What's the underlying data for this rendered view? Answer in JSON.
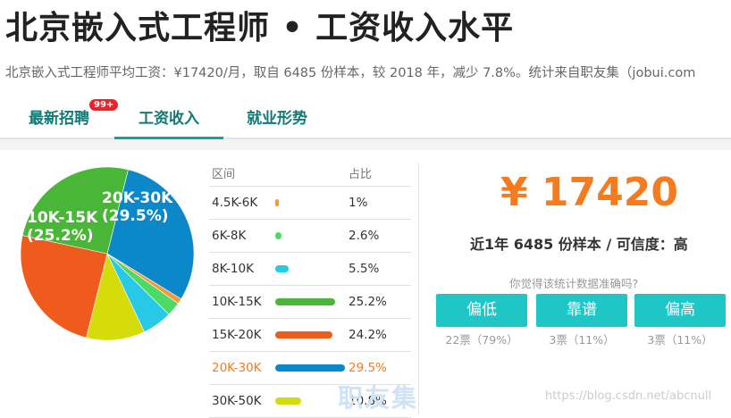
{
  "title": "北京嵌入式工程师 • 工资收入水平",
  "subtitle": "北京嵌入式工程师平均工资：¥17420/月，取自 6485 份样本，较 2018 年，减少 7.8%。统计来自职友集（jobui.com",
  "tabs": [
    {
      "label": "最新招聘",
      "badge": "99+"
    },
    {
      "label": "工资收入"
    },
    {
      "label": "就业形势"
    }
  ],
  "table": {
    "header_range": "区间",
    "header_pct": "占比",
    "rows": [
      {
        "range": "4.5K-6K",
        "pct": "1%",
        "color": "#f49a3a"
      },
      {
        "range": "6K-8K",
        "pct": "2.6%",
        "color": "#4cd964"
      },
      {
        "range": "8K-10K",
        "pct": "5.5%",
        "color": "#27c9e6"
      },
      {
        "range": "10K-15K",
        "pct": "25.2%",
        "color": "#4ab637"
      },
      {
        "range": "15K-20K",
        "pct": "24.2%",
        "color": "#ef5a1d"
      },
      {
        "range": "20K-30K",
        "pct": "29.5%",
        "color": "#0b88c9"
      },
      {
        "range": "30K-50K",
        "pct": "10.8%",
        "color": "#d6dc0a"
      }
    ]
  },
  "pie_labels": {
    "a_range": "20K-30K",
    "a_pct": "(29.5%)",
    "b_range": "10K-15K",
    "b_pct": "(25.2%)"
  },
  "chart_data": {
    "type": "pie",
    "categories": [
      "20K-30K",
      "4.5K-6K",
      "6K-8K",
      "8K-10K",
      "30K-50K",
      "15K-20K",
      "10K-15K"
    ],
    "values": [
      29.5,
      1,
      2.6,
      5.5,
      10.8,
      24.2,
      25.2
    ],
    "colors": [
      "#0b88c9",
      "#f49a3a",
      "#4cd964",
      "#27c9e6",
      "#d6dc0a",
      "#ef5a1d",
      "#4ab637"
    ]
  },
  "salary": "¥ 17420",
  "sample_text": "近1年 6485 份样本 / 可信度：高",
  "question": "你觉得该统计数据准确吗?",
  "votes": [
    {
      "label": "偏低",
      "count": "22票（79%）"
    },
    {
      "label": "靠谱",
      "count": "3票（11%）"
    },
    {
      "label": "偏高",
      "count": "3票（11%）"
    }
  ],
  "watermark": "职友集",
  "url": "https://blog.csdn.net/abcnull"
}
